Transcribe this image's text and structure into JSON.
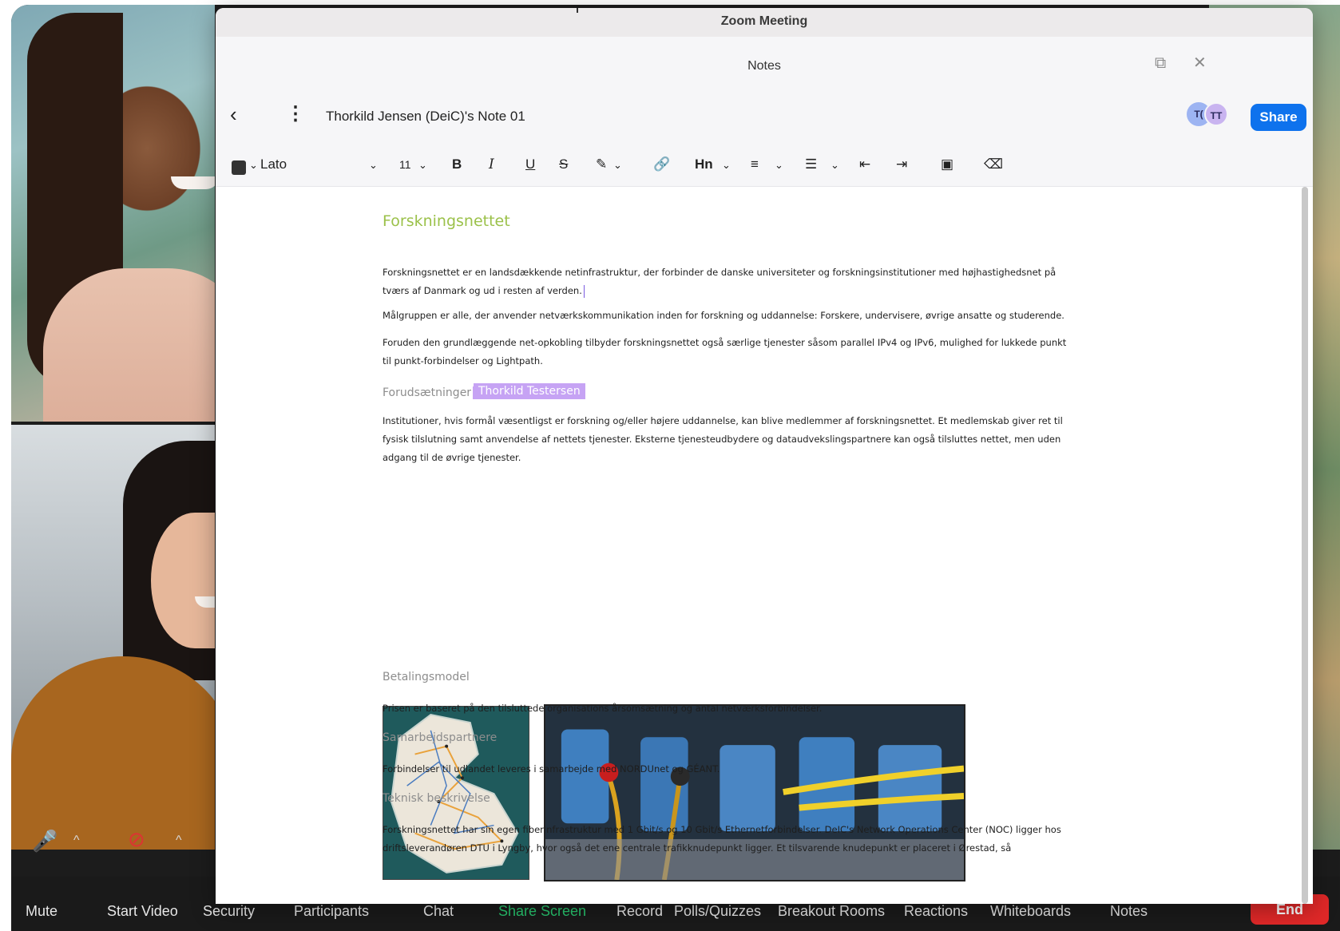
{
  "window": {
    "title": "Zoom Meeting"
  },
  "notes_panel": {
    "title": "Notes"
  },
  "document": {
    "name": "Thorkild Jensen (DeiC)'s Note 01",
    "share_label": "Share",
    "avatars": [
      "T(",
      "TT"
    ]
  },
  "format_toolbar": {
    "font": "Lato",
    "font_size": "11",
    "heading_label": "Hn"
  },
  "content": {
    "title": "Forskningsnettet",
    "para1": "Forskningsnettet er en landsdækkende netinfrastruktur, der forbinder de danske universiteter og forskningsinstitutioner med højhastighedsnet på tværs af Danmark og ud i resten af verden.",
    "para2": "Målgruppen er alle, der anvender netværkskommunikation inden for forskning og uddannelse: Forskere, undervisere, øvrige ansatte og studerende.",
    "para3": "Foruden den grundlæggende net-opkobling tilbyder forskningsnettet også særlige tjenester såsom parallel IPv4 og IPv6, mulighed for lukkede punkt til punkt-forbindelser og Lightpath.",
    "collaborator": "Thorkild Testersen",
    "h_forudsaetninger": "Forudsætninger",
    "para4": "Institutioner, hvis formål væsentligst er forskning og/eller højere uddannelse, kan blive medlemmer af forskningsnettet. Et medlemskab giver ret til fysisk tilslutning samt anvendelse af nettets tjenester. Eksterne tjenesteudbydere og dataudvekslingspartnere kan også tilsluttes nettet, men uden adgang til de øvrige tjenester.",
    "h_betaling": "Betalingsmodel",
    "para5": "Prisen er baseret på den tilsluttede organisations årsomsætning og antal netværksforbindelser.",
    "h_samarbejde": "Samarbejdspartnere",
    "para6": "Forbindelser til udlandet leveres i samarbejde med NORDUnet og GÉANT.",
    "h_teknisk": "Teknisk beskrivelse",
    "para7": "Forskningsnettet har sin egen fiberinfrastruktur med 1 Gbit/s og 10 Gbit/s Ethernetforbindelser. DeIC's Network Operations Center (NOC) ligger hos driftsleverandøren DTU i Lyngby, hvor også det ene centrale trafikknudepunkt ligger. Et tilsvarende knudepunkt er placeret i Ørestad, så"
  },
  "meeting_toolbar": {
    "mute": "Mute",
    "start_video": "Start Video",
    "security": "Security",
    "participants": "Participants",
    "chat": "Chat",
    "share_screen": "Share Screen",
    "record": "Record",
    "polls": "Polls/Quizzes",
    "breakout": "Breakout Rooms",
    "reactions": "Reactions",
    "whiteboards": "Whiteboards",
    "notes": "Notes",
    "end": "End"
  },
  "colors": {
    "accent": "#0e72ed",
    "title_green": "#9bc14a",
    "share_green": "#28c76f",
    "end_red": "#e02828",
    "collaborator_purple": "#c6a3f4"
  }
}
